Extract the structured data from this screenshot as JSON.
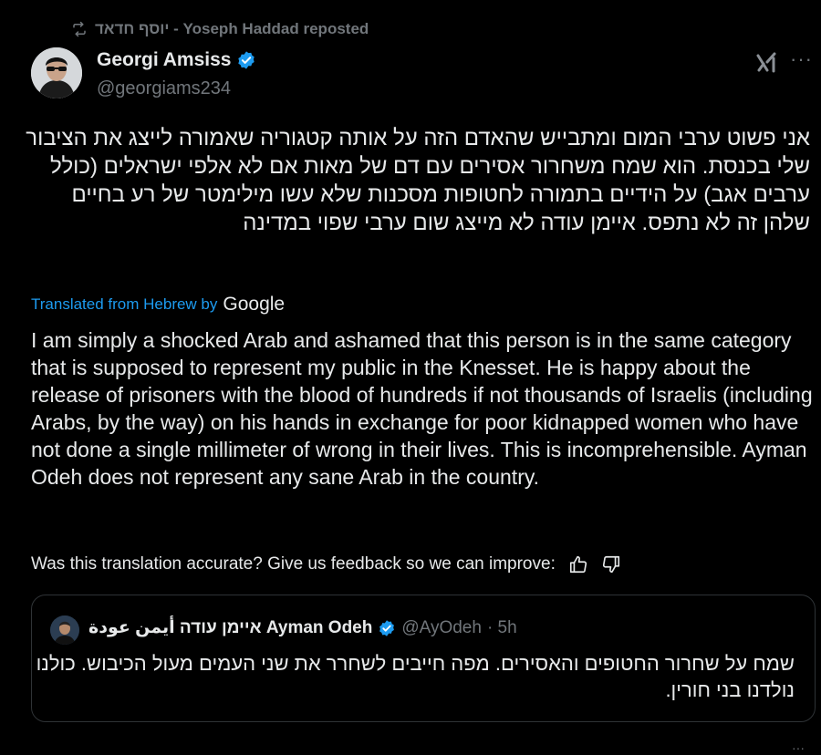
{
  "repost": {
    "text": "יוסף חדאד - Yoseph Haddad reposted",
    "icon": "repost-icon"
  },
  "author": {
    "display_name": "Georgi Amsiss",
    "handle": "@georgiams234",
    "verified": true
  },
  "tweet": {
    "hebrew_text": "אני פשוט ערבי המום ומתבייש שהאדם הזה על אותה קטגוריה שאמורה לייצג את הציבור שלי בכנסת. הוא שמח משחרור אסירים עם דם של מאות אם לא אלפי ישראלים (כולל ערבים אגב) על הידיים בתמורה לחטופות מסכנות שלא עשו מילימטר של רע בחיים שלהן זה לא נתפס. איימן עודה לא מייצג שום ערבי שפוי במדינה",
    "translated_label": "Translated from Hebrew by",
    "translator": "Google",
    "english_text": "I am simply a shocked Arab and ashamed that this person is in the same category that is supposed to represent my public in the Knesset. He is happy about the release of prisoners with the blood of hundreds if not thousands of Israelis (including Arabs, by the way) on his hands in exchange for poor kidnapped women who have not done a single millimeter of wrong in their lives. This is incomprehensible. Ayman Odeh does not represent any sane Arab in the country.",
    "feedback_prompt": "Was this translation accurate? Give us feedback so we can improve:"
  },
  "quote": {
    "display_name": "איימן עודה أيمن عودة Ayman Odeh",
    "handle": "@AyOdeh",
    "time": "· 5h",
    "text": "שמח על שחרור החטופים והאסירים. מפה חייבים לשחרר את שני העמים מעול הכיבוש. כולנו נולדנו בני חורין."
  },
  "colors": {
    "background": "#000000",
    "text": "#e7e9ea",
    "muted": "#71767b",
    "link": "#1d9bf0",
    "verified": "#1d9bf0",
    "border": "#2f3336"
  }
}
